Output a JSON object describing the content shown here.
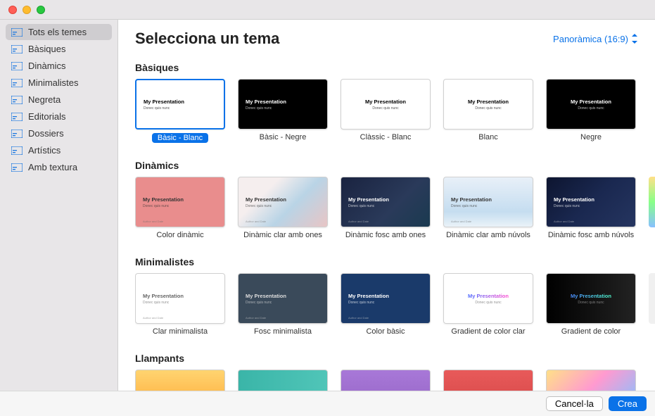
{
  "header": {
    "title": "Selecciona un tema",
    "aspect_label": "Panoràmica (16:9)"
  },
  "sidebar": {
    "items": [
      {
        "label": "Tots els temes"
      },
      {
        "label": "Bàsiques"
      },
      {
        "label": "Dinàmics"
      },
      {
        "label": "Minimalistes"
      },
      {
        "label": "Negreta"
      },
      {
        "label": "Editorials"
      },
      {
        "label": "Dossiers"
      },
      {
        "label": "Artístics"
      },
      {
        "label": "Amb textura"
      }
    ]
  },
  "preview_text": {
    "title": "My Presentation",
    "subtitle": "Donec quis nunc"
  },
  "sections": [
    {
      "title": "Bàsiques",
      "themes": [
        {
          "label": "Bàsic - Blanc",
          "bg": "#ffffff",
          "fg": "#000000",
          "selected": true,
          "align": "left"
        },
        {
          "label": "Bàsic - Negre",
          "bg": "#000000",
          "fg": "#ffffff",
          "align": "left"
        },
        {
          "label": "Clàssic - Blanc",
          "bg": "#ffffff",
          "fg": "#000000",
          "align": "center"
        },
        {
          "label": "Blanc",
          "bg": "#ffffff",
          "fg": "#000000",
          "align": "center"
        },
        {
          "label": "Negre",
          "bg": "#000000",
          "fg": "#ffffff",
          "align": "center"
        }
      ]
    },
    {
      "title": "Dinàmics",
      "themes": [
        {
          "label": "Color dinàmic",
          "bg": "linear-gradient(#e98d8d,#e98d8d)",
          "fg": "#333",
          "align": "left",
          "author": true
        },
        {
          "label": "Dinàmic clar amb ones",
          "bg": "linear-gradient(135deg,#f5eeee 30%,#b9d4e6 60%,#e8c5c5 100%)",
          "fg": "#333",
          "align": "left",
          "author": true
        },
        {
          "label": "Dinàmic fosc amb ones",
          "bg": "linear-gradient(135deg,#1a2340,#2a3a5a 60%,#1a3a50)",
          "fg": "#fff",
          "align": "left",
          "author": true
        },
        {
          "label": "Dinàmic clar amb núvols",
          "bg": "linear-gradient(#e8f0f8,#c5ddf0 70%,#eaf2f8)",
          "fg": "#333",
          "align": "left",
          "author": true
        },
        {
          "label": "Dinàmic fosc amb núvols",
          "bg": "linear-gradient(135deg,#0d1530,#1a2850 50%,#253560)",
          "fg": "#fff",
          "align": "left",
          "author": true
        }
      ]
    },
    {
      "title": "Minimalistes",
      "themes": [
        {
          "label": "Clar minimalista",
          "bg": "#ffffff",
          "fg": "#666",
          "align": "left",
          "author": true
        },
        {
          "label": "Fosc minimalista",
          "bg": "#3a4a5a",
          "fg": "#ddd",
          "align": "left",
          "author": true
        },
        {
          "label": "Color bàsic",
          "bg": "#1a3a6a",
          "fg": "#ffffff",
          "align": "left",
          "author": true
        },
        {
          "label": "Gradient de color clar",
          "bg": "#ffffff",
          "fg": "linear-gradient(90deg,#4a6aff,#ff4ad0)",
          "align": "center",
          "gradient_text": true
        },
        {
          "label": "Gradient de color",
          "bg": "linear-gradient(90deg,#000,#222)",
          "fg": "linear-gradient(90deg,#4a8aff,#50ffd0)",
          "align": "center",
          "gradient_text": true
        }
      ]
    },
    {
      "title": "Llampants",
      "themes": [
        {
          "label": "",
          "bg": "linear-gradient(#ffd470,#ffb040)",
          "strip": true
        },
        {
          "label": "",
          "bg": "linear-gradient(90deg,#3ab5a8,#50c5b8)",
          "strip": true
        },
        {
          "label": "",
          "bg": "linear-gradient(#a878d8,#9868c8)",
          "strip": true
        },
        {
          "label": "",
          "bg": "linear-gradient(#e85a5a,#d84a4a)",
          "strip": true
        },
        {
          "label": "",
          "bg": "linear-gradient(135deg,#ffe088,#ff9ad0,#88c0ff)",
          "strip": true
        }
      ]
    }
  ],
  "footer": {
    "cancel_label": "Cancel·la",
    "create_label": "Crea"
  }
}
